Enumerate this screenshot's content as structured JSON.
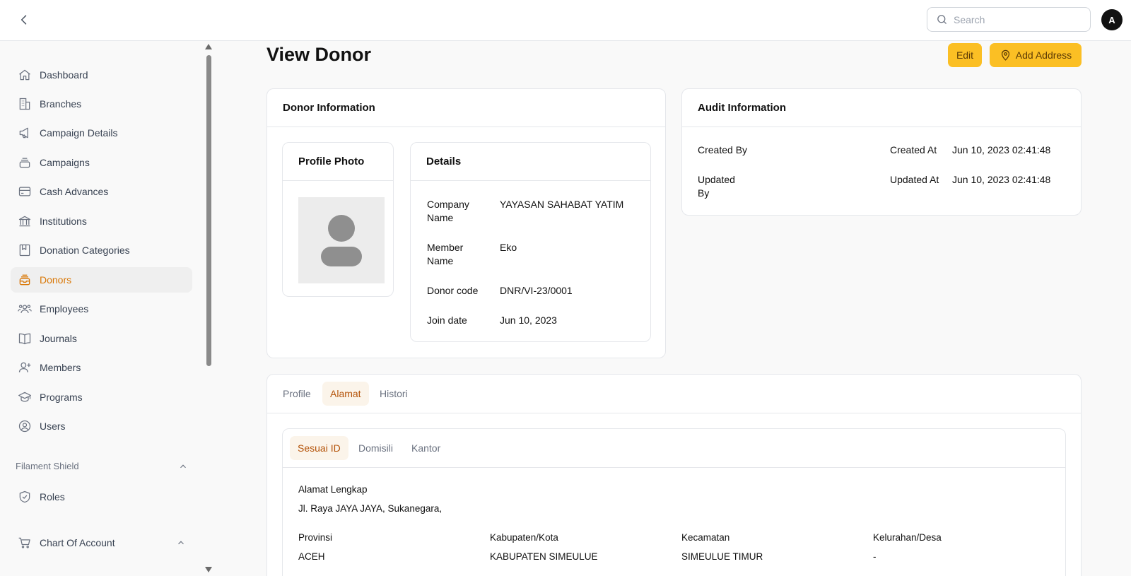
{
  "topbar": {
    "search_placeholder": "Search",
    "avatar_initial": "A"
  },
  "sidebar": {
    "items": [
      {
        "label": "Dashboard",
        "icon": "home-icon"
      },
      {
        "label": "Branches",
        "icon": "building-icon"
      },
      {
        "label": "Campaign Details",
        "icon": "megaphone-icon"
      },
      {
        "label": "Campaigns",
        "icon": "stack-icon"
      },
      {
        "label": "Cash Advances",
        "icon": "credit-card-icon"
      },
      {
        "label": "Institutions",
        "icon": "bank-icon"
      },
      {
        "label": "Donation Categories",
        "icon": "bookmark-icon"
      },
      {
        "label": "Donors",
        "icon": "inbox-stack-icon",
        "active": true
      },
      {
        "label": "Employees",
        "icon": "users-group-icon"
      },
      {
        "label": "Journals",
        "icon": "book-open-icon"
      },
      {
        "label": "Members",
        "icon": "user-plus-icon"
      },
      {
        "label": "Programs",
        "icon": "academic-cap-icon"
      },
      {
        "label": "Users",
        "icon": "user-circle-icon"
      }
    ],
    "groups": [
      {
        "label": "Filament Shield",
        "items": [
          {
            "label": "Roles",
            "icon": "shield-check-icon"
          }
        ]
      },
      {
        "label": "Chart Of Account",
        "items": []
      }
    ],
    "active_color": "#d97706"
  },
  "page": {
    "title": "View Donor",
    "actions": {
      "edit": "Edit",
      "add_address": "Add Address"
    },
    "accent": "#fbbf24"
  },
  "donor_info": {
    "title": "Donor Information",
    "profile_photo": {
      "title": "Profile Photo"
    },
    "details": {
      "title": "Details",
      "rows": [
        {
          "label": "Company Name",
          "value": "YAYASAN SAHABAT YATIM"
        },
        {
          "label": "Member Name",
          "value": "Eko"
        },
        {
          "label": "Donor code",
          "value": "DNR/VI-23/0001"
        },
        {
          "label": "Join date",
          "value": "Jun 10, 2023"
        }
      ]
    }
  },
  "audit": {
    "title": "Audit Information",
    "created_by_label": "Created By",
    "created_by_value": "",
    "created_at_label": "Created At",
    "created_at_value": "Jun 10, 2023 02:41:48",
    "updated_by_label": "Updated By",
    "updated_by_value": "",
    "updated_at_label": "Updated At",
    "updated_at_value": "Jun 10, 2023 02:41:48"
  },
  "tabs": {
    "main": [
      "Profile",
      "Alamat",
      "Histori"
    ],
    "main_active": "Alamat",
    "address": [
      "Sesuai ID",
      "Domisili",
      "Kantor"
    ],
    "address_active": "Sesuai ID"
  },
  "address": {
    "full_label": "Alamat Lengkap",
    "full_value": "Jl. Raya JAYA JAYA, Sukanegara,",
    "fields": [
      {
        "label": "Provinsi",
        "value": "ACEH"
      },
      {
        "label": "Kabupaten/Kota",
        "value": "KABUPATEN SIMEULUE"
      },
      {
        "label": "Kecamatan",
        "value": "SIMEULUE TIMUR"
      },
      {
        "label": "Kelurahan/Desa",
        "value": "-"
      }
    ]
  }
}
